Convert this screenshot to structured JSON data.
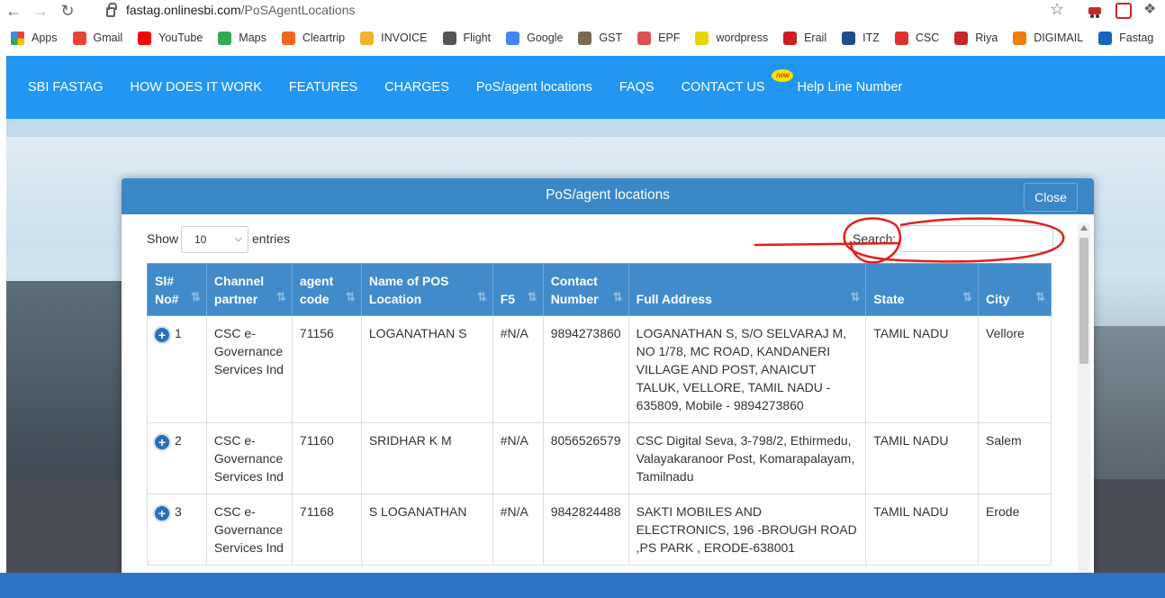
{
  "browser": {
    "url_domain": "fastag.onlinesbi.com",
    "url_path": "/PoSAgentLocations",
    "bookmarks": [
      {
        "label": "Apps",
        "color": "#4285f4"
      },
      {
        "label": "Gmail",
        "color": "#ea4335"
      },
      {
        "label": "YouTube",
        "color": "#ff0000"
      },
      {
        "label": "Maps",
        "color": "#34a853"
      },
      {
        "label": "Cleartrip",
        "color": "#f26722"
      },
      {
        "label": "INVOICE",
        "color": "#f0b429"
      },
      {
        "label": "Flight",
        "color": "#555555"
      },
      {
        "label": "Google",
        "color": "#4285f4"
      },
      {
        "label": "GST",
        "color": "#7a6a4f"
      },
      {
        "label": "EPF",
        "color": "#d9534f"
      },
      {
        "label": "wordpress",
        "color": "#e5d800"
      },
      {
        "label": "Erail",
        "color": "#cc1f1f"
      },
      {
        "label": "ITZ",
        "color": "#1f4e8c"
      },
      {
        "label": "CSC",
        "color": "#e0312d"
      },
      {
        "label": "Riya",
        "color": "#c62828"
      },
      {
        "label": "DIGIMAIL",
        "color": "#f57c00"
      },
      {
        "label": "Fastag",
        "color": "#1565c0"
      }
    ]
  },
  "site_nav": {
    "items": [
      "SBI FASTAG",
      "HOW DOES IT WORK",
      "FEATURES",
      "CHARGES",
      "PoS/agent locations",
      "FAQS",
      "CONTACT US"
    ],
    "badge": "new",
    "helpline": "Help Line Number"
  },
  "modal": {
    "title": "PoS/agent locations",
    "close_label": "Close",
    "show_label": "Show",
    "page_length": "10",
    "entries_label": "entries",
    "search_label": "Search:",
    "search_value": ""
  },
  "table": {
    "headers": [
      "Sl# No#",
      "Channel partner",
      "agent code",
      "Name of POS Location",
      "F5",
      "Contact Number",
      "Full Address",
      "State",
      "City"
    ],
    "rows": [
      {
        "no": "1",
        "partner": "CSC e-Governance Services Ind",
        "code": "71156",
        "name": "LOGANATHAN S",
        "f5": "#N/A",
        "contact": "9894273860",
        "address": "LOGANATHAN S, S/O SELVARAJ M, NO 1/78, MC ROAD, KANDANERI VILLAGE AND POST, ANAICUT TALUK, VELLORE, TAMIL NADU - 635809, Mobile - 9894273860",
        "state": "TAMIL NADU",
        "city": "Vellore"
      },
      {
        "no": "2",
        "partner": "CSC e-Governance Services Ind",
        "code": "71160",
        "name": "SRIDHAR K M",
        "f5": "#N/A",
        "contact": "8056526579",
        "address": "CSC Digital Seva, 3-798/2, Ethirmedu, Valayakaranoor Post, Komarapalayam, Tamilnadu",
        "state": "TAMIL NADU",
        "city": "Salem"
      },
      {
        "no": "3",
        "partner": "CSC e-Governance Services Ind",
        "code": "71168",
        "name": "S LOGANATHAN",
        "f5": "#N/A",
        "contact": "9842824488",
        "address": "SAKTI MOBILES AND ELECTRONICS, 196 -BROUGH ROAD ,PS PARK , ERODE-638001",
        "state": "TAMIL NADU",
        "city": "Erode"
      }
    ]
  },
  "colors": {
    "nav_blue": "#2196f3",
    "modal_header": "#3a87c8",
    "table_header": "#428bca",
    "annotation_red": "#e0201b"
  }
}
